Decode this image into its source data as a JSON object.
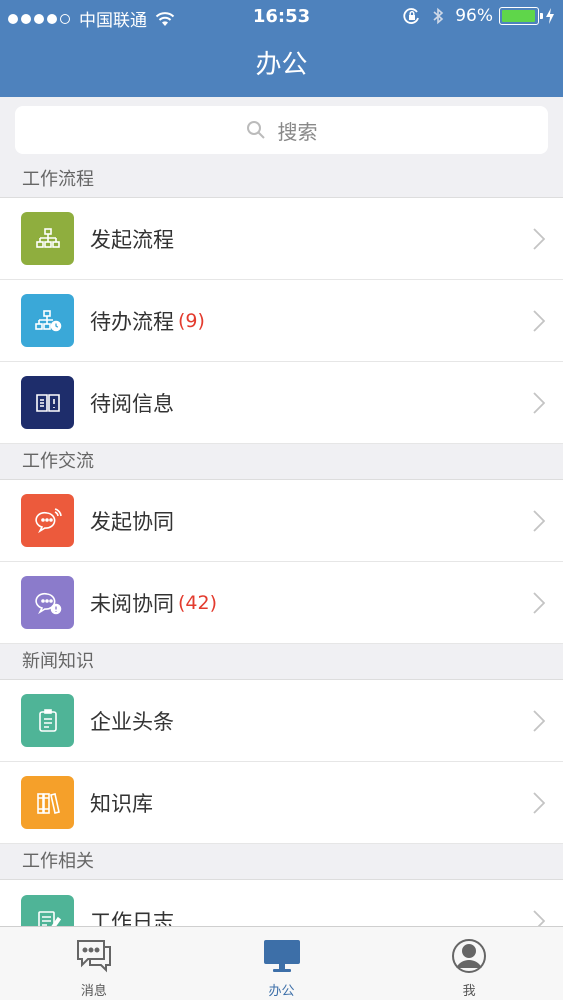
{
  "status_bar": {
    "carrier": "中国联通",
    "time": "16:53",
    "battery": "96%",
    "battery_level": 0.96
  },
  "header": {
    "title": "办公"
  },
  "search": {
    "placeholder": "搜索"
  },
  "sections": [
    {
      "title": "工作流程",
      "items": [
        {
          "label": "发起流程",
          "badge": "",
          "icon": "flowchart-icon",
          "color": "#8fae3e"
        },
        {
          "label": "待办流程",
          "badge": "(9)",
          "icon": "pending-flowchart-icon",
          "color": "#3aa8d8"
        },
        {
          "label": "待阅信息",
          "badge": "",
          "icon": "read-info-icon",
          "color": "#1e2d6b"
        }
      ]
    },
    {
      "title": "工作交流",
      "items": [
        {
          "label": "发起协同",
          "badge": "",
          "icon": "chat-bubble-icon",
          "color": "#ec5a3c"
        },
        {
          "label": "未阅协同",
          "badge": "(42)",
          "icon": "unread-chat-icon",
          "color": "#8b7bcb"
        }
      ]
    },
    {
      "title": "新闻知识",
      "items": [
        {
          "label": "企业头条",
          "badge": "",
          "icon": "clipboard-icon",
          "color": "#4fb497"
        },
        {
          "label": "知识库",
          "badge": "",
          "icon": "books-icon",
          "color": "#f5a02a"
        }
      ]
    },
    {
      "title": "工作相关",
      "items": [
        {
          "label": "工作日志",
          "badge": "",
          "icon": "notepad-icon",
          "color": "#4fb497"
        }
      ]
    }
  ],
  "tabbar": [
    {
      "label": "消息",
      "icon": "message-icon",
      "active": false
    },
    {
      "label": "办公",
      "icon": "monitor-icon",
      "active": true
    },
    {
      "label": "我",
      "icon": "profile-icon",
      "active": false
    }
  ]
}
